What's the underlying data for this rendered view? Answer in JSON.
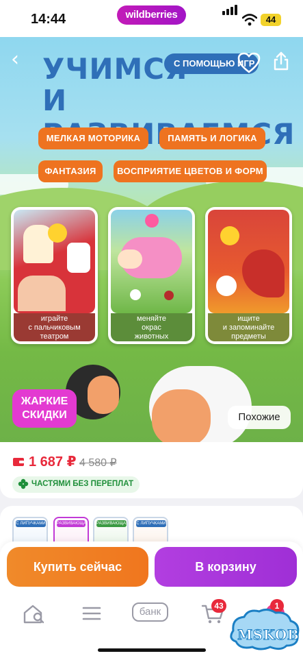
{
  "status_bar": {
    "time": "14:44",
    "store_pill": "wildberries",
    "battery": "44"
  },
  "hero": {
    "title_line1": "УЧИМСЯ",
    "title_line2": "И РАЗВИВАЕМСЯ",
    "games_badge": "С ПОМОЩЬЮ ИГР",
    "tags": [
      "МЕЛКАЯ МОТОРИКА",
      "ПАМЯТЬ И ЛОГИКА",
      "ФАНТАЗИЯ",
      "ВОСПРИЯТИЕ ЦВЕТОВ И ФОРМ"
    ],
    "cards": [
      {
        "caption": "играйте\nс пальчиковым\nтеатром"
      },
      {
        "caption": "меняйте\nокрас\nживотных"
      },
      {
        "caption": "ищите\nи запоминайте\nпредметы"
      }
    ],
    "hot_badge": "ЖАРКИЕ\nСКИДКИ",
    "similar_button": "Похожие"
  },
  "price": {
    "current": "1 687 ₽",
    "old": "4 580 ₽",
    "installment": "ЧАСТЯМИ БЕЗ ПЕРЕПЛАТ"
  },
  "thumbnails": [
    {
      "label": "С ЛИПУЧКАМИ"
    },
    {
      "label": "РАЗВИВАЮЩАЯ"
    },
    {
      "label": "РАЗВИВАЮЩАЯ"
    },
    {
      "label": "С ЛИПУЧКАМИ"
    }
  ],
  "actions": {
    "buy_now": "Купить сейчас",
    "add_to_cart": "В корзину"
  },
  "nav": {
    "bank_label": "банк",
    "cart_badge": "43",
    "profile_badge": "1"
  },
  "watermark": "MSKOB",
  "colors": {
    "accent_purple": "#a315c6",
    "price_red": "#e8293b",
    "tag_orange": "#ee7320",
    "title_blue": "#2f6fb8"
  }
}
